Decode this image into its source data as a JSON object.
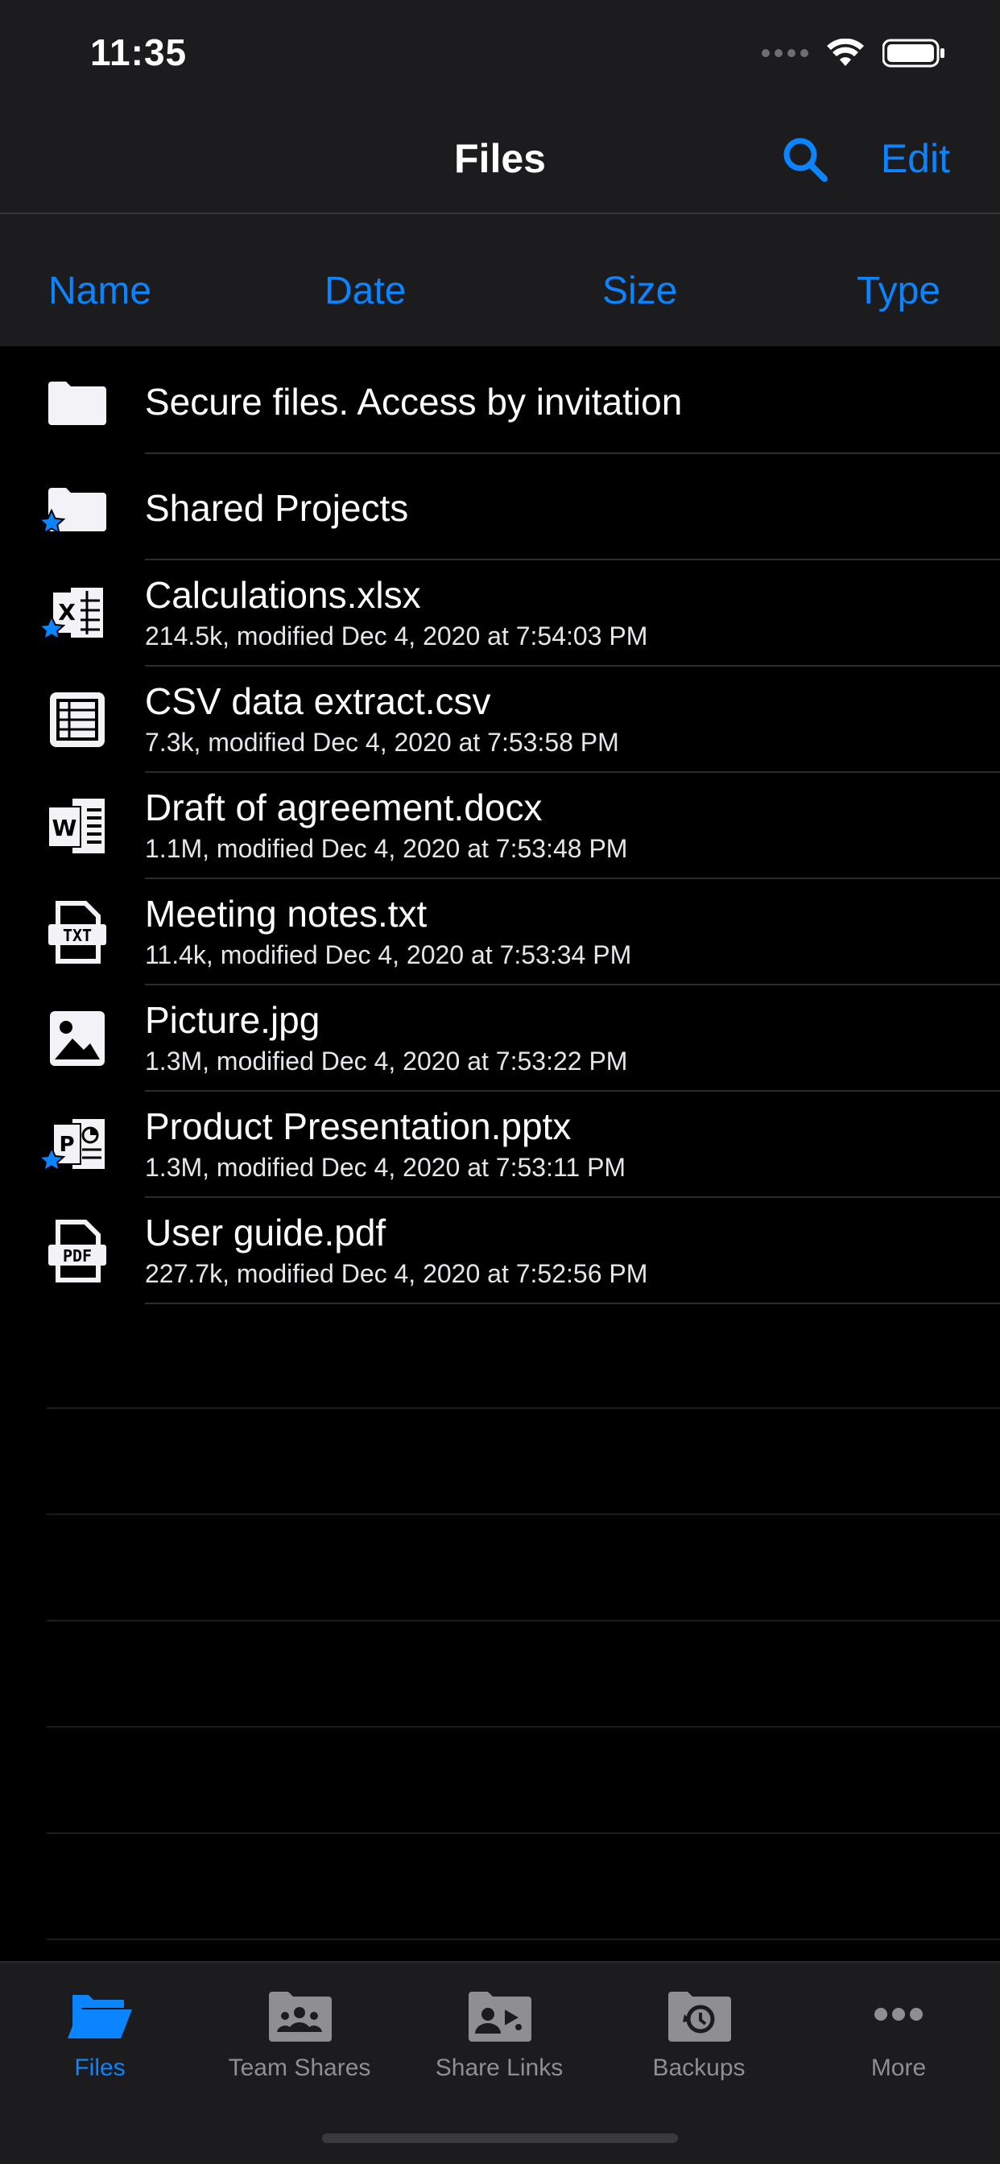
{
  "status_bar": {
    "time": "11:35"
  },
  "nav": {
    "title": "Files",
    "edit_label": "Edit",
    "search_icon": "search-icon"
  },
  "sort_bar": {
    "name": "Name",
    "date": "Date",
    "size": "Size",
    "type": "Type"
  },
  "files": [
    {
      "icon": "folder-icon",
      "favorite": false,
      "name": "Secure files. Access by invitation",
      "meta": ""
    },
    {
      "icon": "folder-icon",
      "favorite": true,
      "name": "Shared Projects",
      "meta": ""
    },
    {
      "icon": "excel-file-icon",
      "favorite": true,
      "name": "Calculations.xlsx",
      "meta": "214.5k, modified Dec 4, 2020 at 7:54:03 PM"
    },
    {
      "icon": "csv-file-icon",
      "favorite": false,
      "name": "CSV data extract.csv",
      "meta": "7.3k, modified Dec 4, 2020 at 7:53:58 PM"
    },
    {
      "icon": "word-file-icon",
      "favorite": false,
      "name": "Draft of agreement.docx",
      "meta": "1.1M, modified Dec 4, 2020 at 7:53:48 PM"
    },
    {
      "icon": "txt-file-icon",
      "favorite": false,
      "name": "Meeting notes.txt",
      "meta": "11.4k, modified Dec 4, 2020 at 7:53:34 PM"
    },
    {
      "icon": "image-file-icon",
      "favorite": false,
      "name": "Picture.jpg",
      "meta": "1.3M, modified Dec 4, 2020 at 7:53:22 PM"
    },
    {
      "icon": "powerpoint-file-icon",
      "favorite": true,
      "name": "Product Presentation.pptx",
      "meta": "1.3M, modified Dec 4, 2020 at 7:53:11 PM"
    },
    {
      "icon": "pdf-file-icon",
      "favorite": false,
      "name": "User guide.pdf",
      "meta": "227.7k, modified Dec 4, 2020 at 7:52:56 PM"
    }
  ],
  "tabs": [
    {
      "label": "Files",
      "icon": "folder-open-icon",
      "active": true
    },
    {
      "label": "Team Shares",
      "icon": "team-folder-icon",
      "active": false
    },
    {
      "label": "Share Links",
      "icon": "share-link-folder-icon",
      "active": false
    },
    {
      "label": "Backups",
      "icon": "backup-folder-icon",
      "active": false
    },
    {
      "label": "More",
      "icon": "more-dots-icon",
      "active": false
    }
  ],
  "colors": {
    "accent": "#0a84ff",
    "background": "#000000",
    "bar_background": "#1c1c1e",
    "secondary_text": "#8e8e93"
  }
}
